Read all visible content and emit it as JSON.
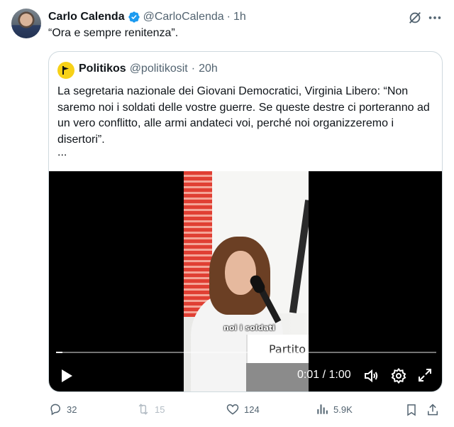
{
  "author": {
    "name": "Carlo Calenda",
    "handle": "@CarloCalenda",
    "time": "1h",
    "text": "“Ora e sempre renitenza”."
  },
  "header_icons": [
    "grok-icon",
    "more-icon"
  ],
  "quoted": {
    "name": "Politikos",
    "handle": "@politikosit",
    "time": "20h",
    "text": "La segretaria nazionale dei Giovani Democratici, Virginia Libero: “Non saremo noi i soldati delle vostre guerre. Se queste destre ci porteranno ad un vero conflitto, alle armi andateci voi, perché noi organizzeremo i disertori”.",
    "ellipsis": "...",
    "avatar_color": "#f7d117",
    "video": {
      "podium_text": "Partito",
      "caption": "noi i soldati",
      "time": "0:01 / 1:00",
      "progress": 0.016
    }
  },
  "actions": {
    "replies": "32",
    "reposts": "15",
    "likes": "124",
    "views": "5.9K"
  },
  "colors": {
    "verified": "#1d9bf0",
    "muted": "#536471",
    "border": "#cfd9de"
  }
}
